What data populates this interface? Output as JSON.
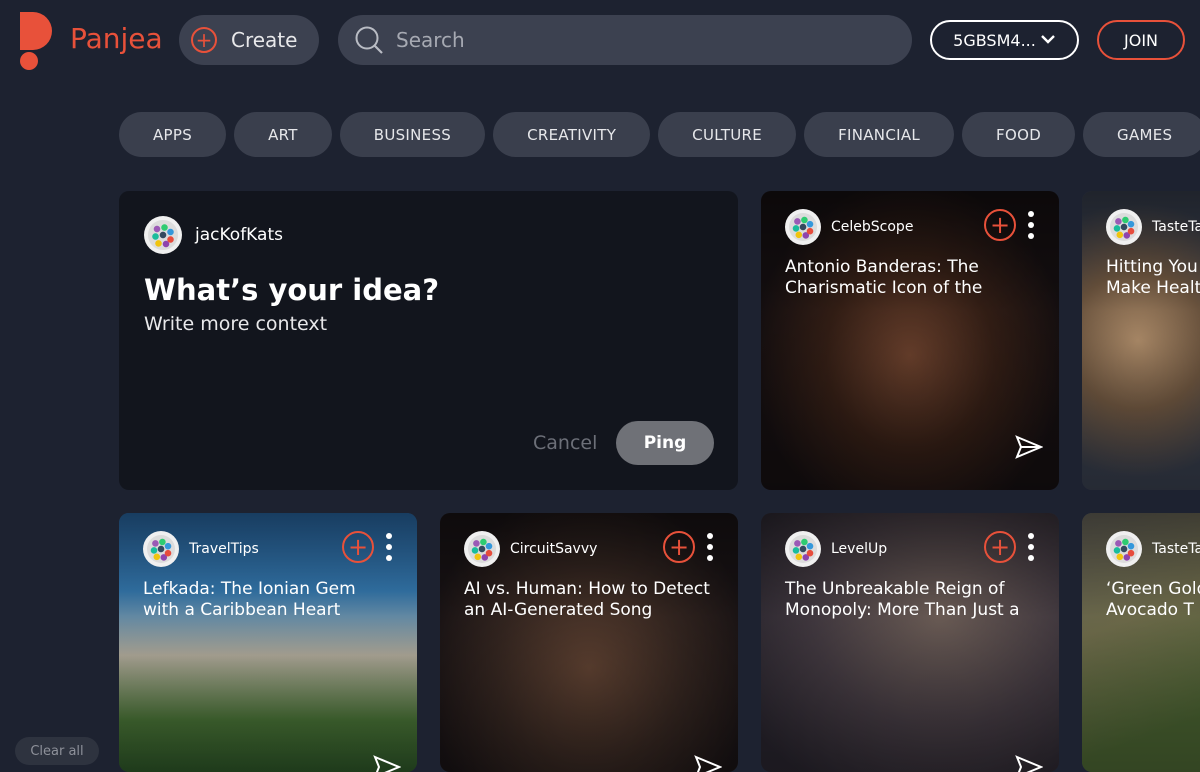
{
  "header": {
    "brand": "Panjea",
    "create_label": "Create",
    "search_placeholder": "Search",
    "account_label": "5GBSM4...",
    "join_label": "JOIN"
  },
  "categories": [
    "APPS",
    "ART",
    "BUSINESS",
    "CREATIVITY",
    "CULTURE",
    "FINANCIAL",
    "FOOD",
    "GAMES"
  ],
  "composer": {
    "username": "jacKofKats",
    "title": "What’s your idea?",
    "context_placeholder": "Write more context",
    "cancel_label": "Cancel",
    "ping_label": "Ping"
  },
  "cards": [
    {
      "source": "CelebScope",
      "title": "Antonio Banderas: The Charismatic Icon of the"
    },
    {
      "source": "TasteTa",
      "title": "Hitting You Make Healt"
    },
    {
      "source": "TravelTips",
      "title": "Lefkada: The Ionian Gem with a Caribbean Heart"
    },
    {
      "source": "CircuitSavvy",
      "title": "AI vs. Human: How to Detect an AI-Generated Song"
    },
    {
      "source": "LevelUp",
      "title": "The Unbreakable Reign of Monopoly: More Than Just a"
    },
    {
      "source": "TasteTa",
      "title": "‘Green Gold Avocado T"
    }
  ],
  "footer": {
    "clear_all_label": "Clear all"
  },
  "colors": {
    "accent": "#e8513a",
    "background": "#1d2230",
    "card_dark": "#12151d"
  },
  "icons": {
    "plus": "plus-circle-icon",
    "search": "search-icon",
    "more": "kebab-menu-icon",
    "send": "send-icon",
    "chevron": "chevron-down-icon"
  }
}
